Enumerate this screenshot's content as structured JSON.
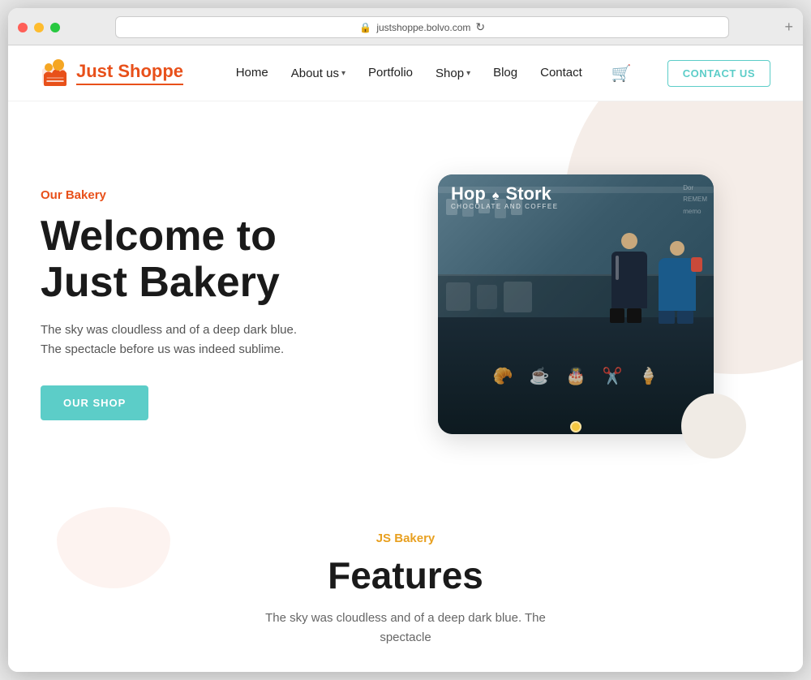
{
  "browser": {
    "url": "justshoppe.bolvo.com",
    "new_tab_label": "+"
  },
  "navbar": {
    "logo_text_just": "Just",
    "logo_text_shoppe": "Shoppe",
    "nav_items": [
      {
        "label": "Home",
        "has_dropdown": false
      },
      {
        "label": "About us",
        "has_dropdown": true
      },
      {
        "label": "Portfolio",
        "has_dropdown": false
      },
      {
        "label": "Shop",
        "has_dropdown": true
      },
      {
        "label": "Blog",
        "has_dropdown": false
      },
      {
        "label": "Contact",
        "has_dropdown": false
      }
    ],
    "contact_btn_label": "CONTACT US"
  },
  "hero": {
    "subtitle": "Our Bakery",
    "title_line1": "Welcome to",
    "title_line2": "Just Bakery",
    "description": "The sky was cloudless and of a deep dark blue. The spectacle before us was indeed sublime.",
    "cta_label": "OUR SHOP",
    "image_sign_hop": "Hop",
    "image_sign_stork": "Stork",
    "image_sign_sub": "CHOCOLATE AND COFFEE"
  },
  "features": {
    "subtitle": "JS Bakery",
    "title": "Features",
    "description": "The sky was cloudless and of a deep dark blue. The spectacle"
  }
}
